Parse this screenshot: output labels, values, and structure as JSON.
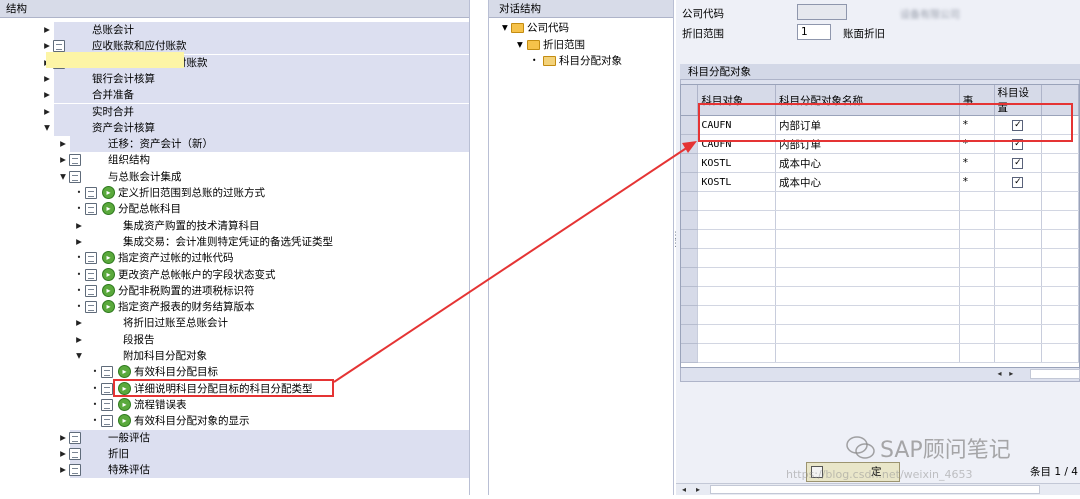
{
  "left_pane": {
    "header": "结构",
    "rows": [
      {
        "label": "总账会计",
        "indent": 0,
        "toggle": "collapsed",
        "icon": "none",
        "highlight": true
      },
      {
        "label": "应收账款和应付账款",
        "indent": 0,
        "toggle": "collapsed",
        "icon": "doc",
        "highlight": true
      },
      {
        "label": "合同科目应收与应付账款",
        "indent": 0,
        "toggle": "collapsed",
        "icon": "doc",
        "highlight": true
      },
      {
        "label": "银行会计核算",
        "indent": 0,
        "toggle": "collapsed",
        "icon": "none",
        "highlight": true
      },
      {
        "label": "合并准备",
        "indent": 0,
        "toggle": "collapsed",
        "icon": "none",
        "highlight": true
      },
      {
        "label": "实时合并",
        "indent": 0,
        "toggle": "collapsed",
        "icon": "none",
        "highlight": true
      },
      {
        "label": "资产会计核算",
        "indent": 0,
        "toggle": "expanded",
        "icon": "none",
        "highlight": true
      },
      {
        "label": "迁移：资产会计（新）",
        "indent": 1,
        "toggle": "collapsed",
        "icon": "none",
        "highlight": true
      },
      {
        "label": "组织结构",
        "indent": 1,
        "toggle": "collapsed",
        "icon": "doc",
        "highlight": false
      },
      {
        "label": "与总账会计集成",
        "indent": 1,
        "toggle": "expanded",
        "icon": "doc",
        "highlight": false
      },
      {
        "label": "定义折旧范围到总账的过账方式",
        "indent": 2,
        "toggle": "bullet",
        "icon": "doc-exec",
        "highlight": false
      },
      {
        "label": "分配总帐科目",
        "indent": 2,
        "toggle": "bullet",
        "icon": "doc-exec",
        "highlight": false
      },
      {
        "label": "集成资产购置的技术清算科目",
        "indent": 2,
        "toggle": "collapsed",
        "icon": "none",
        "highlight": false
      },
      {
        "label": "集成交易：会计准则特定凭证的备选凭证类型",
        "indent": 2,
        "toggle": "collapsed",
        "icon": "none",
        "highlight": false
      },
      {
        "label": "指定资产过帐的过帐代码",
        "indent": 2,
        "toggle": "bullet",
        "icon": "doc-exec",
        "highlight": false
      },
      {
        "label": "更改资产总帐帐户的字段状态变式",
        "indent": 2,
        "toggle": "bullet",
        "icon": "doc-exec",
        "highlight": false
      },
      {
        "label": "分配非税购置的进项税标识符",
        "indent": 2,
        "toggle": "bullet",
        "icon": "doc-exec",
        "highlight": false
      },
      {
        "label": "指定资产报表的财务结算版本",
        "indent": 2,
        "toggle": "bullet",
        "icon": "doc-exec",
        "highlight": false
      },
      {
        "label": "将折旧过账至总账会计",
        "indent": 2,
        "toggle": "collapsed",
        "icon": "none",
        "highlight": false
      },
      {
        "label": "段报告",
        "indent": 2,
        "toggle": "collapsed",
        "icon": "none",
        "highlight": false
      },
      {
        "label": "附加科目分配对象",
        "indent": 2,
        "toggle": "expanded",
        "icon": "none",
        "highlight": false
      },
      {
        "label": "有效科目分配目标",
        "indent": 3,
        "toggle": "bullet",
        "icon": "doc-exec",
        "highlight": false
      },
      {
        "label": "详细说明科目分配目标的科目分配类型",
        "indent": 3,
        "toggle": "bullet",
        "icon": "doc-exec",
        "highlight": false
      },
      {
        "label": "流程错误表",
        "indent": 3,
        "toggle": "bullet",
        "icon": "doc-exec",
        "highlight": false
      },
      {
        "label": "有效科目分配对象的显示",
        "indent": 3,
        "toggle": "bullet",
        "icon": "doc-exec",
        "highlight": false
      },
      {
        "label": "一般评估",
        "indent": 1,
        "toggle": "collapsed",
        "icon": "doc",
        "highlight": true
      },
      {
        "label": "折旧",
        "indent": 1,
        "toggle": "collapsed",
        "icon": "doc",
        "highlight": true
      },
      {
        "label": "特殊评估",
        "indent": 1,
        "toggle": "collapsed",
        "icon": "doc",
        "highlight": true
      }
    ]
  },
  "dialog_structure": {
    "header": "对话结构",
    "items": [
      {
        "label": "公司代码",
        "level": 0
      },
      {
        "label": "折旧范围",
        "level": 1
      },
      {
        "label": "科目分配对象",
        "level": 2,
        "selected": true
      }
    ]
  },
  "detail": {
    "company_code_label": "公司代码",
    "company_code_value": "",
    "company_name_blurred": "设备有限公司",
    "depr_area_label": "折旧范围",
    "depr_area_value": "1",
    "depr_area_desc": "账面折旧",
    "group_title": "科目分配对象",
    "columns": [
      "科目对象",
      "科目分配对象名称",
      "事",
      "科目设置"
    ],
    "rows": [
      {
        "object": "CAUFN",
        "name": "内部订单",
        "event": "*",
        "account_setting": true
      },
      {
        "object": "CAUFN",
        "name": "内部订单",
        "event": "*",
        "account_setting": true
      },
      {
        "object": "KOSTL",
        "name": "成本中心",
        "event": "*",
        "account_setting": true
      },
      {
        "object": "KOSTL",
        "name": "成本中心",
        "event": "*",
        "account_setting": true
      }
    ],
    "empty_row_count": 9,
    "locate_button": "定位...",
    "entry_label": "条目 1 / 4"
  },
  "watermark": {
    "brand": "SAP顾问笔记",
    "url": "https://blog.csdn.net/weixin_4653"
  },
  "colors": {
    "highlight_row": "#dcdff0",
    "annotation_red": "#e53434",
    "selected_item": "#fdf5a6",
    "exec_green": "#5aa93c"
  }
}
